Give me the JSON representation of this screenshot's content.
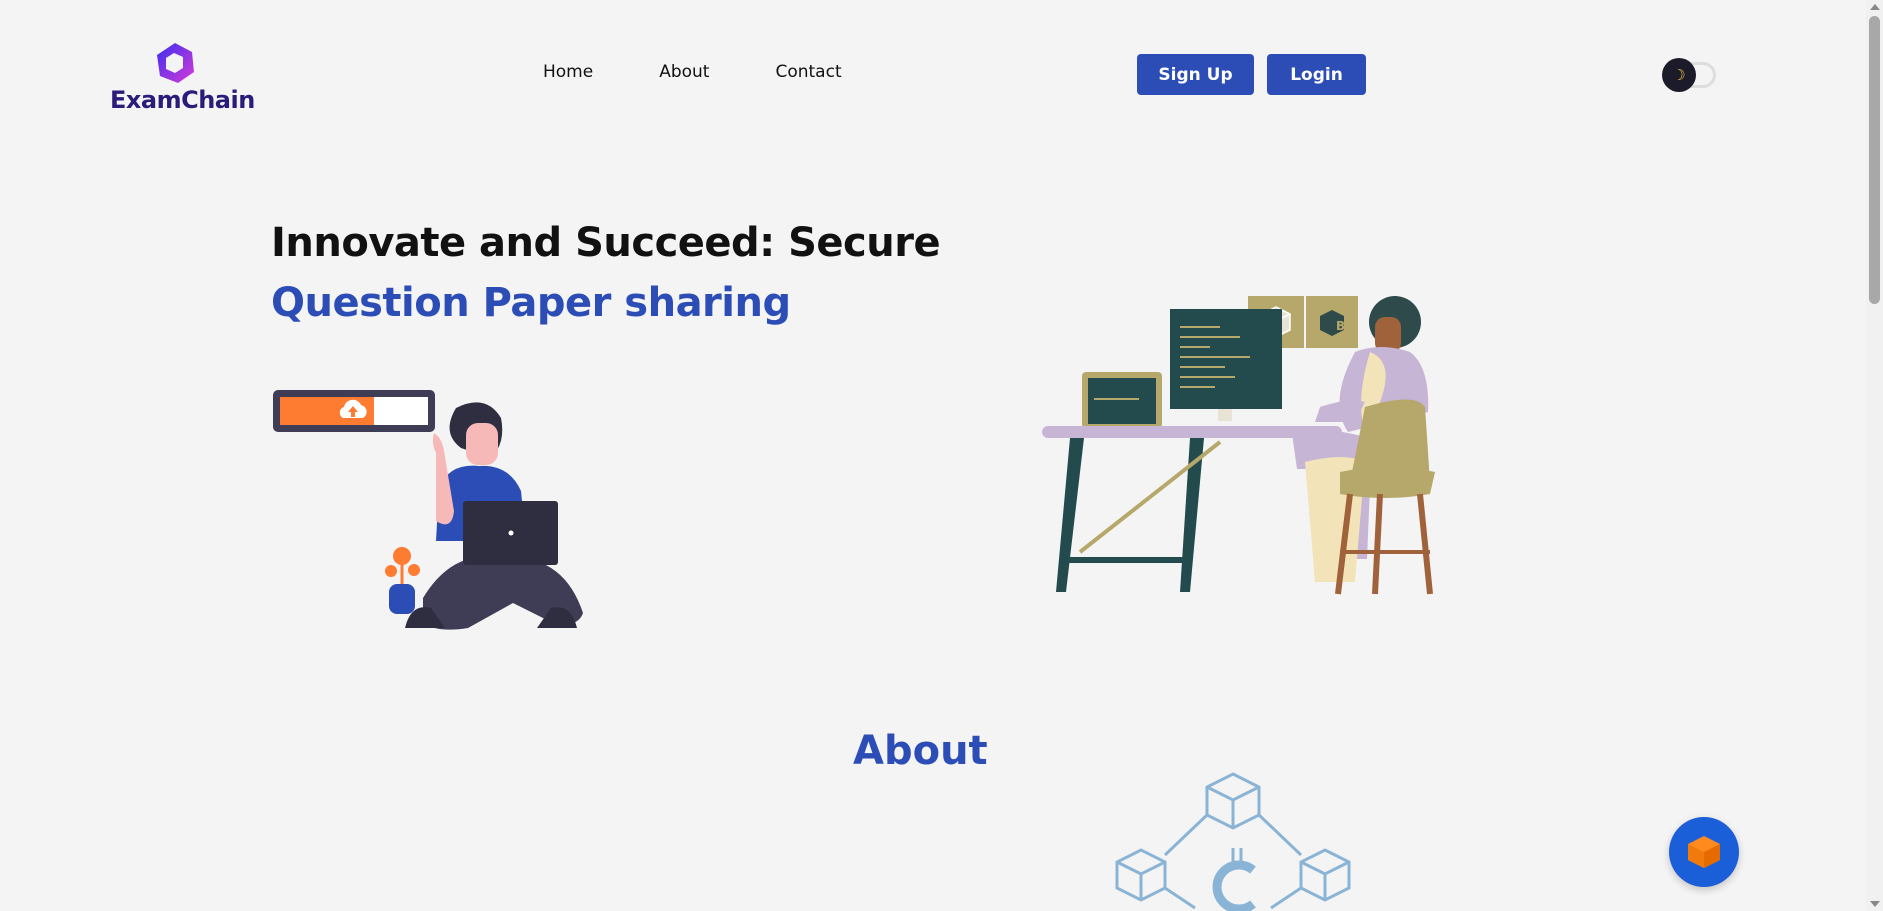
{
  "brand": {
    "name": "ExamChain",
    "logo_icon": "hexagon-ring-icon",
    "colors": {
      "from": "#3b2ff0",
      "to": "#d63bd6"
    }
  },
  "nav": {
    "items": [
      {
        "label": "Home"
      },
      {
        "label": "About"
      },
      {
        "label": "Contact"
      }
    ]
  },
  "auth": {
    "signup_label": "Sign Up",
    "login_label": "Login"
  },
  "theme_toggle": {
    "icon": "moon-icon",
    "state": "dark-mode-off"
  },
  "hero": {
    "line1": "Innovate and Succeed: Secure",
    "line2": "Question Paper sharing"
  },
  "about": {
    "title": "About"
  },
  "colors": {
    "accent": "#2b4db5",
    "text": "#111111",
    "background": "#f4f4f4",
    "orange": "#fe7b32"
  },
  "chat": {
    "icon": "chat-cube-icon"
  }
}
